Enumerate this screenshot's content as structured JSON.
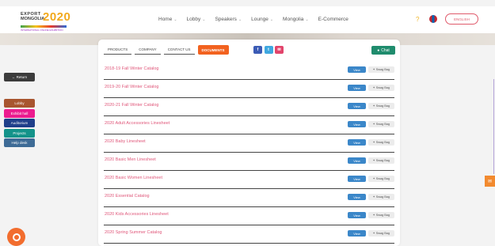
{
  "header": {
    "logo": {
      "line1": "EXPORT",
      "line2": "MONGOLIA",
      "year": "2020",
      "tagline": "INTERNATIONAL ONLINE EXHIBITION"
    },
    "nav": [
      {
        "label": "Home",
        "dropdown": true
      },
      {
        "label": "Lobby",
        "dropdown": true
      },
      {
        "label": "Speakers",
        "dropdown": true
      },
      {
        "label": "Lounge",
        "dropdown": true
      },
      {
        "label": "Mongolia",
        "dropdown": true
      },
      {
        "label": "E-Commerce",
        "dropdown": false
      }
    ],
    "help_icon": "?",
    "language_button": "ENGLISH"
  },
  "sidebar": {
    "return_label": "← Return",
    "menu": [
      {
        "label": "Lobby",
        "color": "#a8552f"
      },
      {
        "label": "Exhibit hall",
        "color": "#ec1c8f"
      },
      {
        "label": "Auditorium",
        "color": "#1f3f8a"
      },
      {
        "label": "Projects",
        "color": "#14938a"
      },
      {
        "label": "Help desk",
        "color": "#3e6b96"
      }
    ]
  },
  "booth": {
    "tabs": [
      {
        "label": "PRODUCTS",
        "active": false
      },
      {
        "label": "COMPANY",
        "active": false
      },
      {
        "label": "CONTACT US",
        "active": false
      },
      {
        "label": "DOCUMENTS",
        "active": true
      }
    ],
    "socials": [
      {
        "icon": "facebook-icon",
        "glyph": "f",
        "color": "#3b5bb5"
      },
      {
        "icon": "twitter-icon",
        "glyph": "t",
        "color": "#3fa8e0"
      },
      {
        "icon": "email-icon",
        "glyph": "✉",
        "color": "#e2446b"
      }
    ],
    "chat_label": "Chat",
    "view_label": "View",
    "bag_label": "Swag Bag",
    "documents": [
      "2018-19 Fall Winter Catalog",
      "2019-20 Fall Winter Catalog",
      "2020-21 Fall Winter Catalog",
      "2020 Adult Accessories Linesheet",
      "2020 Baby Linesheet",
      "2020 Basic Men Linesheet",
      "2020 Basic Women Linesheet",
      "2020 Essential Catalog",
      "2020 Kids Accessories Linesheet",
      "2020 Spring Summer Catalog"
    ]
  }
}
